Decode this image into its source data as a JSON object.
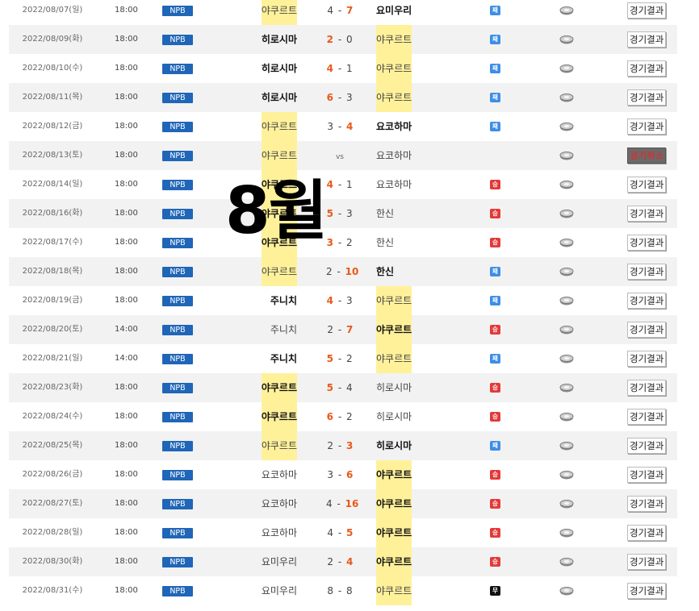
{
  "overlay_text": "8월",
  "rows": [
    {
      "date": "2022/08/07(일)",
      "time": "18:00",
      "league": "NPB",
      "home": "야쿠르트",
      "home_score": "4",
      "away_score": "7",
      "away": "요미우리",
      "winner": "away",
      "hl": "home",
      "badge": "blue",
      "badge_text": "패",
      "result": "경기결과",
      "cancelled": false
    },
    {
      "date": "2022/08/09(화)",
      "time": "18:00",
      "league": "NPB",
      "home": "히로시마",
      "home_score": "2",
      "away_score": "0",
      "away": "야쿠르트",
      "winner": "home",
      "hl": "away",
      "badge": "blue",
      "badge_text": "패",
      "result": "경기결과",
      "cancelled": false
    },
    {
      "date": "2022/08/10(수)",
      "time": "18:00",
      "league": "NPB",
      "home": "히로시마",
      "home_score": "4",
      "away_score": "1",
      "away": "야쿠르트",
      "winner": "home",
      "hl": "away",
      "badge": "blue",
      "badge_text": "패",
      "result": "경기결과",
      "cancelled": false
    },
    {
      "date": "2022/08/11(목)",
      "time": "18:00",
      "league": "NPB",
      "home": "히로시마",
      "home_score": "6",
      "away_score": "3",
      "away": "야쿠르트",
      "winner": "home",
      "hl": "away",
      "badge": "blue",
      "badge_text": "패",
      "result": "경기결과",
      "cancelled": false
    },
    {
      "date": "2022/08/12(금)",
      "time": "18:00",
      "league": "NPB",
      "home": "야쿠르트",
      "home_score": "3",
      "away_score": "4",
      "away": "요코하마",
      "winner": "away",
      "hl": "home",
      "badge": "blue",
      "badge_text": "패",
      "result": "경기결과",
      "cancelled": false
    },
    {
      "date": "2022/08/13(토)",
      "time": "18:00",
      "league": "NPB",
      "home": "야쿠르트",
      "home_score": "",
      "away_score": "",
      "vs": "vs",
      "away": "요코하마",
      "winner": "none",
      "hl": "home",
      "badge": "",
      "badge_text": "",
      "result": "경기취소",
      "cancelled": true
    },
    {
      "date": "2022/08/14(일)",
      "time": "18:00",
      "league": "NPB",
      "home": "야쿠르트",
      "home_score": "4",
      "away_score": "1",
      "away": "요코하마",
      "winner": "home",
      "hl": "home",
      "badge": "red",
      "badge_text": "승",
      "result": "경기결과",
      "cancelled": false
    },
    {
      "date": "2022/08/16(화)",
      "time": "18:00",
      "league": "NPB",
      "home": "야쿠르트",
      "home_score": "5",
      "away_score": "3",
      "away": "한신",
      "winner": "home",
      "hl": "home",
      "badge": "red",
      "badge_text": "승",
      "result": "경기결과",
      "cancelled": false
    },
    {
      "date": "2022/08/17(수)",
      "time": "18:00",
      "league": "NPB",
      "home": "야쿠르트",
      "home_score": "3",
      "away_score": "2",
      "away": "한신",
      "winner": "home",
      "hl": "home",
      "badge": "red",
      "badge_text": "승",
      "result": "경기결과",
      "cancelled": false
    },
    {
      "date": "2022/08/18(목)",
      "time": "18:00",
      "league": "NPB",
      "home": "야쿠르트",
      "home_score": "2",
      "away_score": "10",
      "away": "한신",
      "winner": "away",
      "hl": "home",
      "badge": "blue",
      "badge_text": "패",
      "result": "경기결과",
      "cancelled": false
    },
    {
      "date": "2022/08/19(금)",
      "time": "18:00",
      "league": "NPB",
      "home": "주니치",
      "home_score": "4",
      "away_score": "3",
      "away": "야쿠르트",
      "winner": "home",
      "hl": "away",
      "badge": "blue",
      "badge_text": "패",
      "result": "경기결과",
      "cancelled": false
    },
    {
      "date": "2022/08/20(토)",
      "time": "14:00",
      "league": "NPB",
      "home": "주니치",
      "home_score": "2",
      "away_score": "7",
      "away": "야쿠르트",
      "winner": "away",
      "hl": "away",
      "badge": "red",
      "badge_text": "승",
      "result": "경기결과",
      "cancelled": false
    },
    {
      "date": "2022/08/21(일)",
      "time": "14:00",
      "league": "NPB",
      "home": "주니치",
      "home_score": "5",
      "away_score": "2",
      "away": "야쿠르트",
      "winner": "home",
      "hl": "away",
      "badge": "blue",
      "badge_text": "패",
      "result": "경기결과",
      "cancelled": false
    },
    {
      "date": "2022/08/23(화)",
      "time": "18:00",
      "league": "NPB",
      "home": "야쿠르트",
      "home_score": "5",
      "away_score": "4",
      "away": "히로시마",
      "winner": "home",
      "hl": "home",
      "badge": "red",
      "badge_text": "승",
      "result": "경기결과",
      "cancelled": false
    },
    {
      "date": "2022/08/24(수)",
      "time": "18:00",
      "league": "NPB",
      "home": "야쿠르트",
      "home_score": "6",
      "away_score": "2",
      "away": "히로시마",
      "winner": "home",
      "hl": "home",
      "badge": "red",
      "badge_text": "승",
      "result": "경기결과",
      "cancelled": false
    },
    {
      "date": "2022/08/25(목)",
      "time": "18:00",
      "league": "NPB",
      "home": "야쿠르트",
      "home_score": "2",
      "away_score": "3",
      "away": "히로시마",
      "winner": "away",
      "hl": "home",
      "badge": "blue",
      "badge_text": "패",
      "result": "경기결과",
      "cancelled": false
    },
    {
      "date": "2022/08/26(금)",
      "time": "18:00",
      "league": "NPB",
      "home": "요코하마",
      "home_score": "3",
      "away_score": "6",
      "away": "야쿠르트",
      "winner": "away",
      "hl": "away",
      "badge": "red",
      "badge_text": "승",
      "result": "경기결과",
      "cancelled": false
    },
    {
      "date": "2022/08/27(토)",
      "time": "18:00",
      "league": "NPB",
      "home": "요코하마",
      "home_score": "4",
      "away_score": "16",
      "away": "야쿠르트",
      "winner": "away",
      "hl": "away",
      "badge": "red",
      "badge_text": "승",
      "result": "경기결과",
      "cancelled": false
    },
    {
      "date": "2022/08/28(일)",
      "time": "18:00",
      "league": "NPB",
      "home": "요코하마",
      "home_score": "4",
      "away_score": "5",
      "away": "야쿠르트",
      "winner": "away",
      "hl": "away",
      "badge": "red",
      "badge_text": "승",
      "result": "경기결과",
      "cancelled": false
    },
    {
      "date": "2022/08/30(화)",
      "time": "18:00",
      "league": "NPB",
      "home": "요미우리",
      "home_score": "2",
      "away_score": "4",
      "away": "야쿠르트",
      "winner": "away",
      "hl": "away",
      "badge": "red",
      "badge_text": "승",
      "result": "경기결과",
      "cancelled": false
    },
    {
      "date": "2022/08/31(수)",
      "time": "18:00",
      "league": "NPB",
      "home": "요미우리",
      "home_score": "8",
      "away_score": "8",
      "away": "야쿠르트",
      "winner": "none",
      "hl": "away",
      "badge": "black",
      "badge_text": "무",
      "result": "경기결과",
      "cancelled": false
    }
  ]
}
